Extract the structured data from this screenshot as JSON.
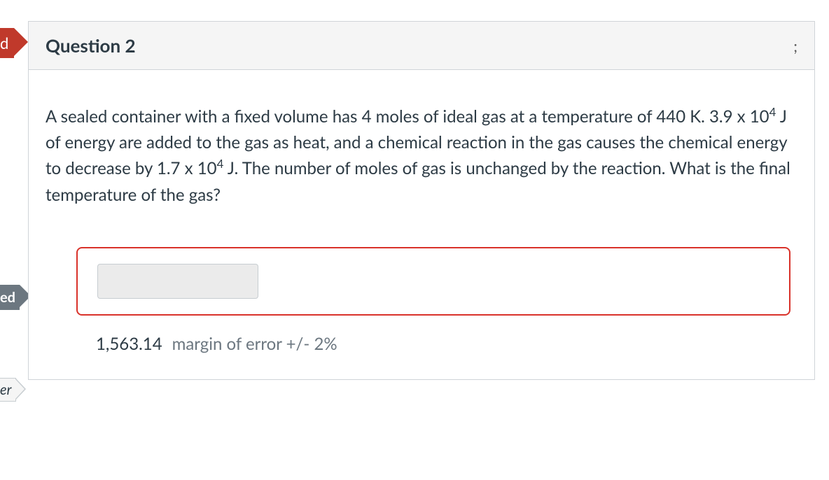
{
  "badges": {
    "top": "d",
    "ed": "ed",
    "er": "er"
  },
  "question": {
    "title": "Question 2",
    "points_suffix": ";",
    "text_html": "A sealed container with a fixed volume has 4 moles of ideal gas at a temperature of 440 K.  3.9 x 10<sup>4</sup> J of energy are added to the gas as heat, and a chemical reaction in the gas causes the chemical energy to decrease by 1.7 x 10<sup>4</sup> J.  The number of moles of gas is unchanged by the reaction.  What is the final temperature of the gas?",
    "answer_input_value": "",
    "correct_answer": "1,563.14",
    "margin_label": "margin of error +/- 2%"
  }
}
